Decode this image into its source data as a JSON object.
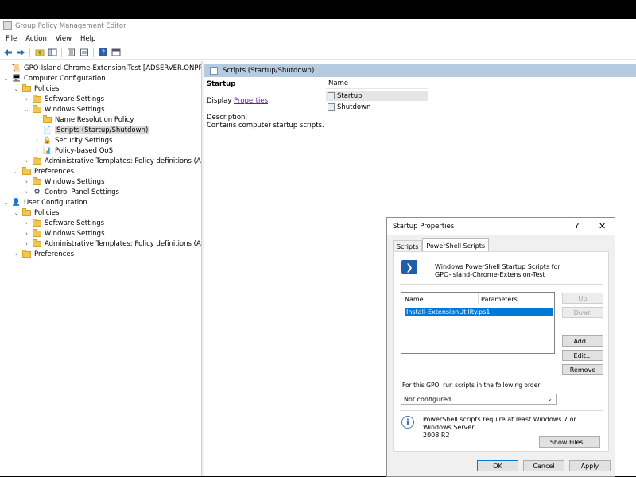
{
  "app": {
    "title": "Group Policy Management Editor"
  },
  "menu": [
    "File",
    "Action",
    "View",
    "Help"
  ],
  "toolbar": {
    "icons": [
      "back-icon",
      "forward-icon",
      "up-folder-icon",
      "show-hide-tree-icon",
      "export-list-icon",
      "properties-icon",
      "help-icon",
      "console-icon"
    ]
  },
  "tree": {
    "items": [
      {
        "label": "GPO-Island-Chrome-Extension-Test [ADSERVER.ONPREM.SOF",
        "level": 0,
        "expand": "",
        "icon": "gpo-icon"
      },
      {
        "label": "Computer Configuration",
        "level": 0,
        "expand": "open",
        "icon": "computer-icon"
      },
      {
        "label": "Policies",
        "level": 1,
        "expand": "open",
        "icon": "folder-icon"
      },
      {
        "label": "Software Settings",
        "level": 2,
        "expand": "closed",
        "icon": "folder-icon"
      },
      {
        "label": "Windows Settings",
        "level": 2,
        "expand": "open",
        "icon": "folder-icon"
      },
      {
        "label": "Name Resolution Policy",
        "level": 3,
        "expand": "",
        "icon": "folder-icon"
      },
      {
        "label": "Scripts (Startup/Shutdown)",
        "level": 3,
        "expand": "",
        "icon": "scripts-icon",
        "selected": true
      },
      {
        "label": "Security Settings",
        "level": 3,
        "expand": "closed",
        "icon": "security-icon"
      },
      {
        "label": "Policy-based QoS",
        "level": 3,
        "expand": "closed",
        "icon": "chart-icon"
      },
      {
        "label": "Administrative Templates: Policy definitions (ADM",
        "level": 2,
        "expand": "closed",
        "icon": "folder-icon"
      },
      {
        "label": "Preferences",
        "level": 1,
        "expand": "open",
        "icon": "folder-icon"
      },
      {
        "label": "Windows Settings",
        "level": 2,
        "expand": "closed",
        "icon": "folder-icon"
      },
      {
        "label": "Control Panel Settings",
        "level": 2,
        "expand": "closed",
        "icon": "control-panel-icon"
      },
      {
        "label": "User Configuration",
        "level": 0,
        "expand": "open",
        "icon": "user-icon"
      },
      {
        "label": "Policies",
        "level": 1,
        "expand": "open",
        "icon": "folder-icon"
      },
      {
        "label": "Software Settings",
        "level": 2,
        "expand": "closed",
        "icon": "folder-icon"
      },
      {
        "label": "Windows Settings",
        "level": 2,
        "expand": "closed",
        "icon": "folder-icon"
      },
      {
        "label": "Administrative Templates: Policy definitions (ADM",
        "level": 2,
        "expand": "closed",
        "icon": "folder-icon"
      },
      {
        "label": "Preferences",
        "level": 1,
        "expand": "closed",
        "icon": "folder-icon"
      }
    ]
  },
  "details": {
    "header": "Scripts (Startup/Shutdown)",
    "section_title": "Startup",
    "display_label": "Display",
    "display_link": "Properties",
    "description_label": "Description:",
    "description_text": "Contains computer startup scripts.",
    "list_header": "Name",
    "items": [
      "Startup",
      "Shutdown"
    ]
  },
  "dialog": {
    "title": "Startup Properties",
    "help": "?",
    "close": "✕",
    "tabs": [
      "Scripts",
      "PowerShell Scripts"
    ],
    "heading_line1": "Windows PowerShell Startup Scripts for",
    "heading_line2": "GPO-Island-Chrome-Extension-Test",
    "col_name": "Name",
    "col_params": "Parameters",
    "script": "Install-ExtensionUtility.ps1",
    "up": "Up",
    "down": "Down",
    "add": "Add...",
    "edit": "Edit...",
    "remove": "Remove",
    "order_label": "For this GPO, run scripts in the following order:",
    "order_value": "Not configured",
    "info_line1": "PowerShell scripts require at least Windows 7 or Windows Server",
    "info_line2": "2008 R2",
    "show_files": "Show Files...",
    "ok": "OK",
    "cancel": "Cancel",
    "apply": "Apply"
  }
}
